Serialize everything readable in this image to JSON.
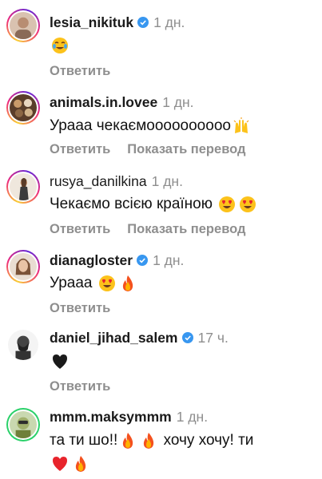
{
  "actions": {
    "reply_label": "Ответить",
    "translate_label": "Показать перевод"
  },
  "colors": {
    "username": "#1a1a1a",
    "secondary": "#8e8e8e",
    "verified": "#3897f0"
  },
  "comments": [
    {
      "username": "lesia_nikituk",
      "verified": true,
      "time": "1 дн.",
      "text": "",
      "emojis": [
        "tears-of-joy-emoji"
      ],
      "show_translate": false
    },
    {
      "username": "animals.in.lovee",
      "verified": false,
      "time": "1 дн.",
      "text": "Урааа чекаємоооооооооо",
      "emojis": [
        "raising-hands-emoji"
      ],
      "show_translate": true
    },
    {
      "username": "rusya_danilkina",
      "verified": false,
      "time": "1 дн.",
      "text": "Чекаємо всією країною",
      "emojis": [
        "heart-eyes-emoji",
        "heart-eyes-emoji"
      ],
      "show_translate": true
    },
    {
      "username": "dianagloster",
      "verified": true,
      "time": "1 дн.",
      "text": "Урааа",
      "emojis": [
        "heart-eyes-emoji",
        "fire-emoji"
      ],
      "show_translate": false
    },
    {
      "username": "daniel_jihad_salem",
      "verified": true,
      "time": "17 ч.",
      "text": "",
      "emojis": [
        "black-heart-emoji"
      ],
      "show_translate": false
    },
    {
      "username": "mmm.maksymmm",
      "verified": false,
      "time": "1 дн.",
      "text_line1": "та ти шо!!",
      "text_line1_end": "хочу хочу! ти",
      "emojis_line1": [
        "fire-emoji",
        "fire-emoji"
      ],
      "emojis_line2": [
        "red-heart-emoji",
        "fire-emoji"
      ],
      "show_translate": false
    }
  ]
}
